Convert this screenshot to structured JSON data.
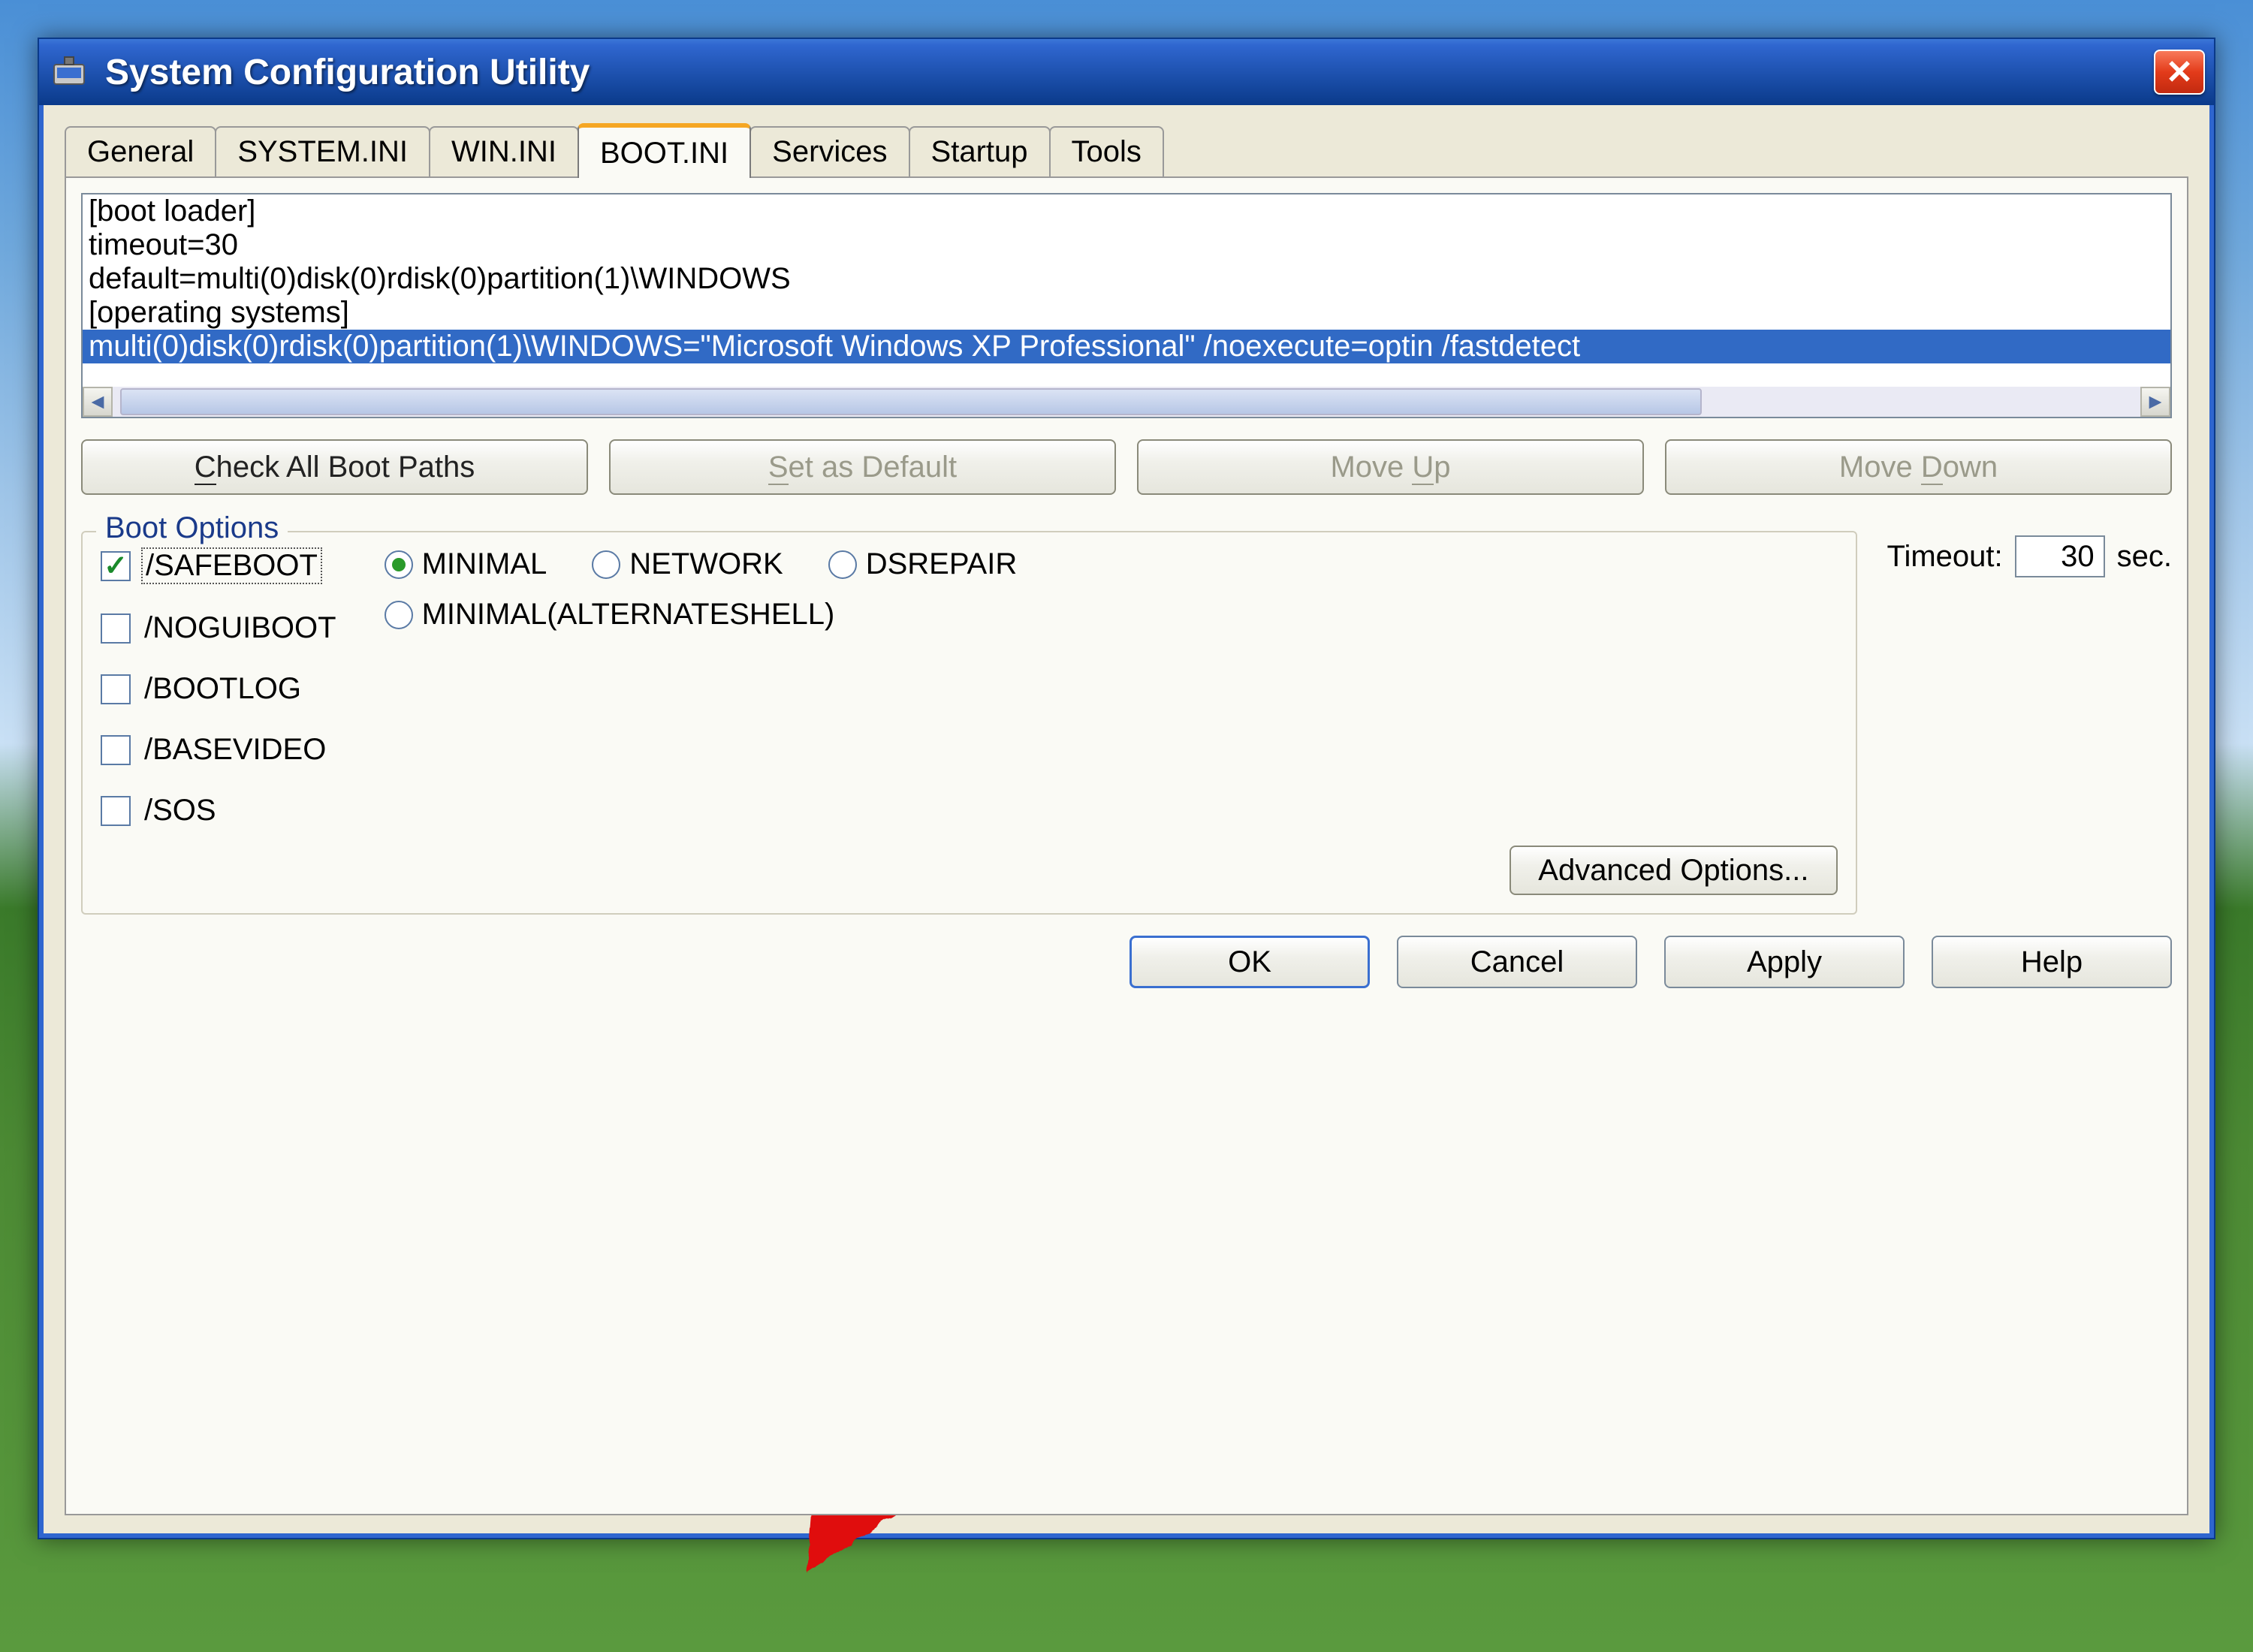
{
  "window": {
    "title": "System Configuration Utility"
  },
  "tabs": [
    "General",
    "SYSTEM.INI",
    "WIN.INI",
    "BOOT.INI",
    "Services",
    "Startup",
    "Tools"
  ],
  "active_tab_index": 3,
  "bootini": {
    "lines": [
      "[boot loader]",
      "timeout=30",
      "default=multi(0)disk(0)rdisk(0)partition(1)\\WINDOWS",
      "[operating systems]",
      "multi(0)disk(0)rdisk(0)partition(1)\\WINDOWS=\"Microsoft Windows XP Professional\" /noexecute=optin /fastdetect"
    ],
    "selected_index": 4
  },
  "buttons": {
    "check_paths": "Check All Boot Paths",
    "set_default": "Set as Default",
    "move_up": "Move Up",
    "move_down": "Move Down",
    "advanced": "Advanced Options...",
    "ok": "OK",
    "cancel": "Cancel",
    "apply": "Apply",
    "help": "Help"
  },
  "boot_options": {
    "legend": "Boot Options",
    "checks": [
      {
        "label": "/SAFEBOOT",
        "checked": true
      },
      {
        "label": "/NOGUIBOOT",
        "checked": false
      },
      {
        "label": "/BOOTLOG",
        "checked": false
      },
      {
        "label": "/BASEVIDEO",
        "checked": false
      },
      {
        "label": "/SOS",
        "checked": false
      }
    ],
    "radios": [
      {
        "label": "MINIMAL",
        "selected": true
      },
      {
        "label": "NETWORK",
        "selected": false
      },
      {
        "label": "DSREPAIR",
        "selected": false
      },
      {
        "label": "MINIMAL(ALTERNATESHELL)",
        "selected": false
      }
    ],
    "timeout": {
      "label": "Timeout:",
      "value": "30",
      "suffix": "sec."
    }
  }
}
